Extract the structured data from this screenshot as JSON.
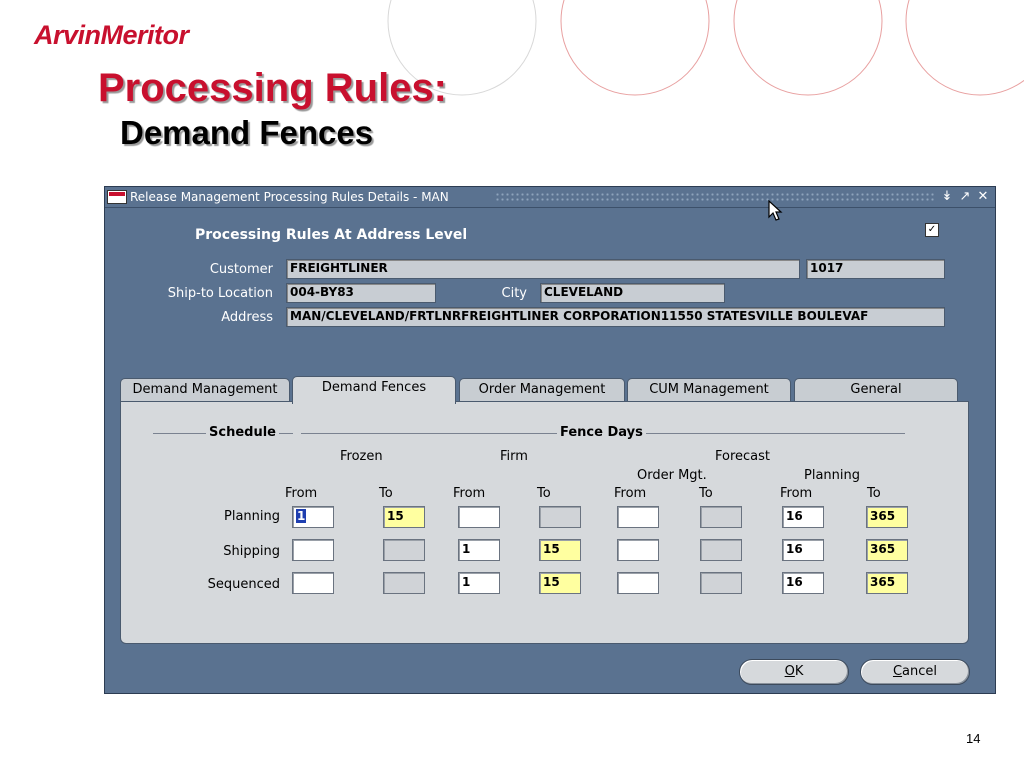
{
  "slide": {
    "logo": "ArvinMeritor",
    "title": "Processing Rules:",
    "subtitle": "Demand Fences",
    "page_number": "14"
  },
  "window": {
    "title": "Release Management Processing Rules Details - MAN",
    "heading": "Processing Rules At Address Level",
    "customer_label": "Customer",
    "customer_value": "FREIGHTLINER",
    "customer_number": "1017",
    "ship_to_label": "Ship-to Location",
    "ship_to_value": "004-BY83",
    "city_label": "City",
    "city_value": "CLEVELAND",
    "address_label": "Address",
    "address_value": "MAN/CLEVELAND/FRTLNRFREIGHTLINER CORPORATION11550 STATESVILLE BOULEVAF"
  },
  "tabs": [
    {
      "label": "Demand Management"
    },
    {
      "label": "Demand Fences"
    },
    {
      "label": "Order Management"
    },
    {
      "label": "CUM Management"
    },
    {
      "label": "General"
    }
  ],
  "active_tab": "Demand Fences",
  "fences": {
    "schedule_group": "Schedule",
    "fence_days_group": "Fence Days",
    "frozen": "Frozen",
    "firm": "Firm",
    "forecast": "Forecast",
    "order_mgt": "Order Mgt.",
    "planning_head": "Planning",
    "from": "From",
    "to": "To",
    "rows": [
      {
        "label": "Planning",
        "values": [
          "1",
          "15",
          "",
          "",
          "",
          "",
          "16",
          "365"
        ]
      },
      {
        "label": "Shipping",
        "values": [
          "",
          "",
          "1",
          "15",
          "",
          "",
          "16",
          "365"
        ]
      },
      {
        "label": "Sequenced",
        "values": [
          "",
          "",
          "1",
          "15",
          "",
          "",
          "16",
          "365"
        ]
      }
    ]
  },
  "buttons": {
    "ok_mnemonic": "O",
    "ok_rest": "K",
    "cancel_mnemonic": "C",
    "cancel_rest": "ancel"
  }
}
